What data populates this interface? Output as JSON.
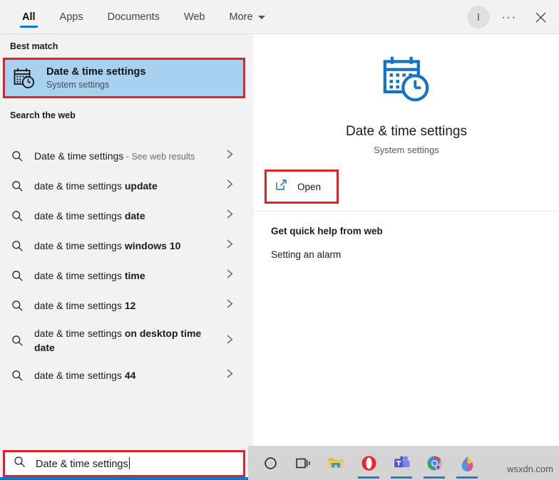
{
  "topbar": {
    "tabs": [
      {
        "label": "All",
        "active": true
      },
      {
        "label": "Apps",
        "active": false
      },
      {
        "label": "Documents",
        "active": false
      },
      {
        "label": "Web",
        "active": false
      },
      {
        "label": "More",
        "active": false,
        "has_caret": true
      }
    ],
    "avatar_initial": "I",
    "ellipsis_label": "···",
    "close_label": "Close",
    "accent_color": "#0078d7"
  },
  "left": {
    "best_match_heading": "Best match",
    "best_match": {
      "title": "Date & time settings",
      "subtitle": "System settings",
      "icon": "calendar-clock-icon",
      "highlight_color": "#e02424",
      "selected_background": "#a8d0f0"
    },
    "search_web_heading": "Search the web",
    "web_results": [
      {
        "plain": "Date & time settings",
        "bold": "",
        "suffix_grey": " - See web results",
        "icon": "search-icon"
      },
      {
        "plain": "date & time settings ",
        "bold": "update",
        "suffix_grey": "",
        "icon": "search-icon"
      },
      {
        "plain": "date & time settings ",
        "bold": "date",
        "suffix_grey": "",
        "icon": "search-icon"
      },
      {
        "plain": "date & time settings ",
        "bold": "windows 10",
        "suffix_grey": "",
        "icon": "search-icon"
      },
      {
        "plain": "date & time settings ",
        "bold": "time",
        "suffix_grey": "",
        "icon": "search-icon"
      },
      {
        "plain": "date & time settings ",
        "bold": "12",
        "suffix_grey": "",
        "icon": "search-icon"
      },
      {
        "plain": "date & time settings ",
        "bold": "on desktop time date",
        "suffix_grey": "",
        "icon": "search-icon",
        "two_line": true
      },
      {
        "plain": "date & time settings ",
        "bold": "44",
        "suffix_grey": "",
        "icon": "search-icon"
      }
    ]
  },
  "right": {
    "hero_icon": "calendar-clock-icon",
    "hero_title": "Date & time settings",
    "hero_subtitle": "System settings",
    "open_button": {
      "label": "Open",
      "icon": "open-external-icon"
    },
    "quick_help_heading": "Get quick help from web",
    "quick_help_items": [
      "Setting an alarm"
    ]
  },
  "search": {
    "value": "Date & time settings",
    "icon": "search-icon",
    "highlight_color": "#e02424"
  },
  "taskbar": {
    "items": [
      {
        "name": "cortana-icon",
        "running": false
      },
      {
        "name": "task-view-icon",
        "running": false
      },
      {
        "name": "file-explorer-icon",
        "running": false
      },
      {
        "name": "opera-icon",
        "running": true
      },
      {
        "name": "microsoft-teams-icon",
        "running": true
      },
      {
        "name": "google-chrome-icon",
        "running": true
      },
      {
        "name": "paint-3d-icon",
        "running": true
      }
    ],
    "watermark": "wsxdn.com"
  }
}
